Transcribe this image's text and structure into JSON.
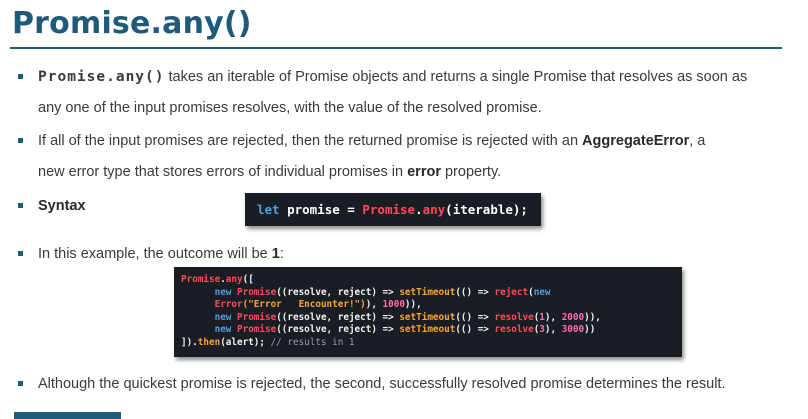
{
  "title": "Promise.any()",
  "bullets": [
    {
      "code": "Promise.any()",
      "text_1": " takes an iterable of Promise objects and returns a single Promise that resolves as soon as",
      "text_2": "any one of the input promises resolves, with the value of the resolved promise."
    },
    {
      "text_1": "If all of the input promises are rejected, then the returned promise is rejected with an ",
      "bold_1": "AggregateError",
      "text_2": ", a",
      "text_3": "new error type that stores errors of individual promises in ",
      "bold_2": "error",
      "text_4": " property."
    },
    {
      "label": "Syntax"
    },
    {
      "text_1": "In this example, the outcome will be ",
      "bold": "1",
      "text_2": ":"
    },
    {
      "text": "Although the quickest promise is rejected, the second, successfully resolved promise determines the result."
    }
  ],
  "syntax_code": {
    "kw": "let",
    "var": " promise = ",
    "cls": "Promise",
    "dot": ".",
    "fn": "any",
    "args": "(iterable);"
  },
  "example_code": {
    "l1_a": "Promise",
    "l1_b": ".",
    "l1_c": "any",
    "l1_d": "([",
    "l2_indent": "      ",
    "l2_new": "new",
    "l2_sp": " ",
    "l2_cls": "Promise",
    "l2_mid": "((resolve, reject) => ",
    "l2_st": "setTimeout",
    "l2_mid2": "(() => ",
    "l2_fn": "reject",
    "l2_open": "(",
    "l2_new2": "new",
    "l3_indent": "      ",
    "l3_cls": "Error",
    "l3_str": "(\"Error   Encounter!\")",
    "l3_mid": "), ",
    "l3_num": "1000",
    "l3_end": ")),",
    "l4_indent": "      ",
    "l4_new": "new",
    "l4_sp": " ",
    "l4_cls": "Promise",
    "l4_mid": "((resolve, reject) => ",
    "l4_st": "setTimeout",
    "l4_mid2": "(() => ",
    "l4_fn": "resolve",
    "l4_a": "(",
    "l4_n1": "1",
    "l4_b": "), ",
    "l4_n2": "2000",
    "l4_end": ")),",
    "l5_indent": "      ",
    "l5_new": "new",
    "l5_sp": " ",
    "l5_cls": "Promise",
    "l5_mid": "((resolve, reject) => ",
    "l5_st": "setTimeout",
    "l5_mid2": "(() => ",
    "l5_fn": "resolve",
    "l5_a": "(",
    "l5_n1": "3",
    "l5_b": "), ",
    "l5_n2": "3000",
    "l5_end": "))",
    "l6_a": "]).",
    "l6_fn": "then",
    "l6_b": "(alert); ",
    "l6_cm": "// results in 1"
  },
  "colors": {
    "title": "#1f5a7a",
    "code_bg": "#1b1d24",
    "keyword": "#4f9fe0",
    "class": "#ff4a5a",
    "string": "#f7a531",
    "number": "#ff6bb0"
  }
}
